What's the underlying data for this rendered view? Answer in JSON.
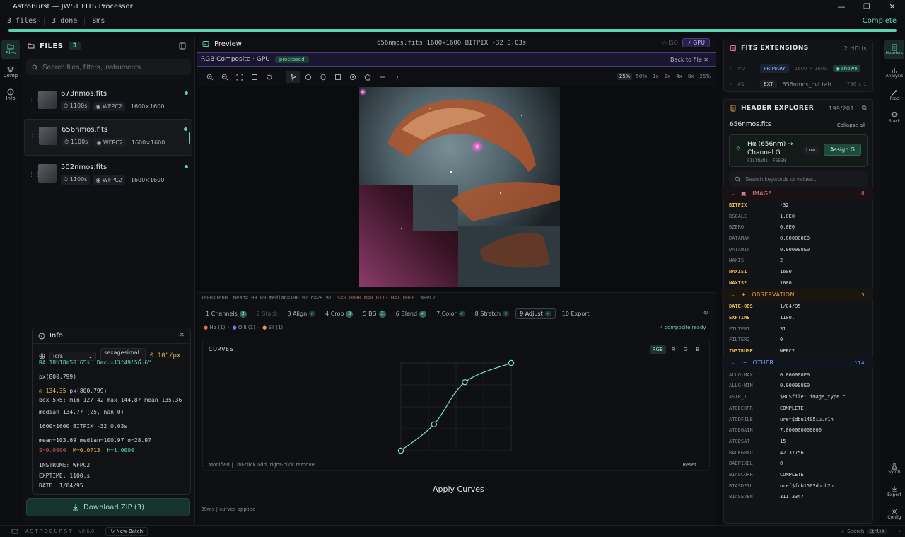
{
  "window": {
    "title": "AstroBurst — JWST FITS Processor",
    "controls": [
      "—",
      "❐",
      "✕"
    ]
  },
  "status": {
    "files": "3 files",
    "done": "3 done",
    "time": "8ms",
    "state": "Complete",
    "progress": 1.0
  },
  "rail": {
    "items": [
      {
        "label": "Files",
        "icon": "folder-icon"
      },
      {
        "label": "Comp",
        "icon": "layers-icon"
      },
      {
        "label": "Info",
        "icon": "info-icon"
      }
    ]
  },
  "files": {
    "title": "FILES",
    "count": "3",
    "search_placeholder": "Search files, filters, instruments...",
    "items": [
      {
        "name": "673nmos.fits",
        "exptime": "1100s",
        "instrument": "WFPC2",
        "dims": "1600×1600"
      },
      {
        "name": "656nmos.fits",
        "exptime": "1100s",
        "instrument": "WFPC2",
        "dims": "1600×1600"
      },
      {
        "name": "502nmos.fits",
        "exptime": "1100s",
        "instrument": "WFPC2",
        "dims": "1600×1600"
      }
    ],
    "download_label": "Download ZIP (3)"
  },
  "info": {
    "title": "Info",
    "frame": "icrs",
    "format": "sexagesimal",
    "scale": "0.10\"/px",
    "ra": "RA 18h18m50.65s",
    "dec": "Dec -13°49'56.6\"",
    "px": "px(800,799)",
    "pixel_value": "134.35",
    "pixel_px": "px(800,799)",
    "box": "box 5×5: min 127.42 max 144.87 mean 135.36",
    "median": "median 134.77  (25, nan 0)",
    "dims_line": "1600×1600  BITPIX -32  0.03s",
    "stats_line": "mean=103.69  median=100.97  σ=28.97",
    "stretch_s": "S=0.0000",
    "stretch_m": "M=0.0713",
    "stretch_h": "H=1.0000",
    "instrume": "INSTRUME: WFPC2",
    "exptime": "EXPTIME: 1100.s",
    "date": "DATE: 1/04/95"
  },
  "preview": {
    "title": "Preview",
    "file_info": "656nmos.fits  1600×1600  BITPIX -32  0.03s",
    "iso_label": "ISO",
    "gpu_label": "GPU",
    "composite_label": "RGB Composite · GPU",
    "processed_label": "processed",
    "back_label": "Back to file  ✕",
    "zoom_levels": [
      "25%",
      "50%",
      "1x",
      "2x",
      "4x",
      "8x",
      "25%"
    ],
    "stats": {
      "dims": "1600×1600",
      "stats": "mean=103.69  median=100.97  σ=28.97",
      "stretch": "S=0.0000  M=0.0713  H=1.0000",
      "instrument": "WFPC2"
    },
    "steps": [
      {
        "label": "1 Channels",
        "badge": "3"
      },
      {
        "label": "2 Stack",
        "badge": ""
      },
      {
        "label": "3 Align",
        "badge": "✓"
      },
      {
        "label": "4 Crop",
        "badge": "3"
      },
      {
        "label": "5 BG",
        "badge": "3"
      },
      {
        "label": "6 Blend",
        "badge": "✓"
      },
      {
        "label": "7 Color",
        "badge": "✓"
      },
      {
        "label": "8 Stretch",
        "badge": "✓"
      },
      {
        "label": "9 Adjust",
        "badge": "✓"
      },
      {
        "label": "10 Export",
        "badge": ""
      }
    ],
    "channels": [
      {
        "label": "Hα",
        "count": "(1)",
        "color": "#e06b5a"
      },
      {
        "label": "OIII",
        "count": "(1)",
        "color": "#5a8be0"
      },
      {
        "label": "SII",
        "count": "(1)",
        "color": "#e0a04f"
      }
    ],
    "composite_ready": "✓ composite ready",
    "curves": {
      "title": "CURVES",
      "channels": [
        "RGB",
        "R",
        "G",
        "B"
      ],
      "footer": "Modified | Dbl-click add, right-click remove",
      "reset": "Reset",
      "points": [
        [
          0,
          0
        ],
        [
          0.3,
          0.3
        ],
        [
          0.58,
          0.78
        ],
        [
          1.0,
          1.0
        ]
      ]
    },
    "apply_label": "Apply Curves",
    "footer": "39ms | curves applied"
  },
  "extensions": {
    "title": "FITS EXTENSIONS",
    "count": "2 HDUs",
    "rows": [
      {
        "index": "#0",
        "type": "PRIMARY",
        "dims": "1600 × 1600",
        "status": "shown"
      },
      {
        "index": "#1",
        "type": "EXT",
        "name": "656nmos_cvt.tab",
        "dims": "796 × 1"
      }
    ]
  },
  "header_explorer": {
    "title": "HEADER EXPLORER",
    "count": "199/201",
    "file": "656nmos.fits",
    "collapse_label": "Collapse all",
    "tip_title": "Hα (656nm) → Channel G",
    "tip_sub": "FILTNAM1: F656N",
    "tip_confidence": "Low",
    "assign_label": "Assign G",
    "search_placeholder": "Search keywords or values...",
    "sections": [
      {
        "name": "IMAGE",
        "count": "8",
        "style": "image",
        "rows": [
          {
            "k": "BITPIX",
            "v": "-32",
            "hl": true
          },
          {
            "k": "BSCALE",
            "v": "1.0E0"
          },
          {
            "k": "BZERO",
            "v": "0.0E0"
          },
          {
            "k": "DATAMAX",
            "v": "0.000000E0"
          },
          {
            "k": "DATAMIN",
            "v": "0.000000E0"
          },
          {
            "k": "NAXIS",
            "v": "2"
          },
          {
            "k": "NAXIS1",
            "v": "1600",
            "hl": true
          },
          {
            "k": "NAXIS2",
            "v": "1600",
            "hl": true
          }
        ]
      },
      {
        "name": "OBSERVATION",
        "count": "5",
        "style": "obs",
        "rows": [
          {
            "k": "DATE-OBS",
            "v": "1/04/95",
            "hl": true
          },
          {
            "k": "EXPTIME",
            "v": "1100.",
            "hl": true
          },
          {
            "k": "FILTER1",
            "v": "31"
          },
          {
            "k": "FILTER2",
            "v": "0"
          },
          {
            "k": "INSTRUME",
            "v": "WFPC2",
            "hl": true
          }
        ]
      },
      {
        "name": "OTHER",
        "count": "174",
        "style": "other",
        "rows": [
          {
            "k": "ALLG-MAX",
            "v": "0.000000E0"
          },
          {
            "k": "ALLG-MIN",
            "v": "0.000000E0"
          },
          {
            "k": "ASTR_I",
            "v": "$RCSfile: image_type.c..."
          },
          {
            "k": "ATODCORR",
            "v": "COMPLETE"
          },
          {
            "k": "ATODFILE",
            "v": "uref$dbu1405iu.r1h"
          },
          {
            "k": "ATODGAIN",
            "v": "7.000000000000"
          },
          {
            "k": "ATODSAT",
            "v": "15"
          },
          {
            "k": "BACKGRND",
            "v": "42.37756"
          },
          {
            "k": "BADPIXEL",
            "v": "0"
          },
          {
            "k": "BIASCORR",
            "v": "COMPLETE"
          },
          {
            "k": "BIASDFIL",
            "v": "uref$fcb1503du.b2h"
          },
          {
            "k": "BIASEVEN",
            "v": "311.3347"
          }
        ]
      }
    ]
  },
  "right_rail": {
    "top": [
      {
        "label": "Headers",
        "icon": "file-text-icon"
      },
      {
        "label": "Analysis",
        "icon": "bar-chart-icon"
      },
      {
        "label": "Proc",
        "icon": "wand-icon"
      },
      {
        "label": "Stack",
        "icon": "stack-icon"
      }
    ],
    "bottom": [
      {
        "label": "Synth",
        "icon": "flask-icon"
      },
      {
        "label": "Export",
        "icon": "download-icon"
      },
      {
        "label": "Config",
        "icon": "gear-icon"
      }
    ]
  },
  "bottom": {
    "brand": "ASTROBURST",
    "version": "v0.6.0",
    "new_batch": "New Batch",
    "search": "Search",
    "shortcut": "Ctrl+K"
  }
}
